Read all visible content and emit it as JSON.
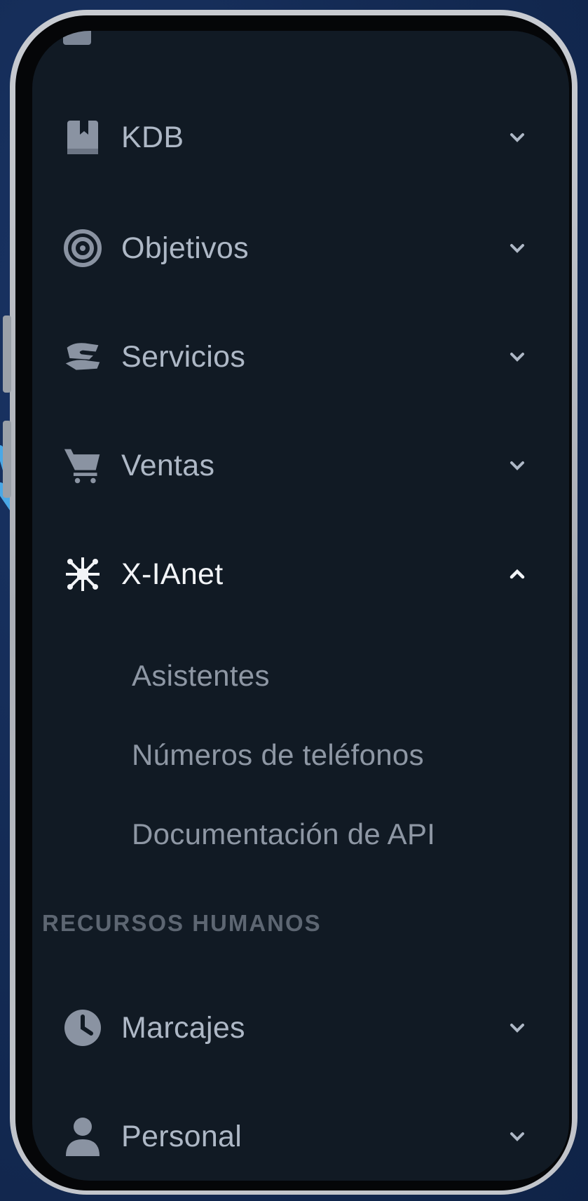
{
  "colors": {
    "background": "#13294f",
    "screen": "#111a24",
    "menu_text": "#aeb8c6",
    "active_text": "#f2f4f7",
    "sub_text": "#8e97a4",
    "section_text": "#5d6672",
    "arrow": "#4aa8e6"
  },
  "sidebar": {
    "items": [
      {
        "label": "KDB",
        "icon": "book-icon",
        "state": "collapsed"
      },
      {
        "label": "Objetivos",
        "icon": "target-icon",
        "state": "collapsed"
      },
      {
        "label": "Servicios",
        "icon": "hand-holding-icon",
        "state": "collapsed"
      },
      {
        "label": "Ventas",
        "icon": "cart-icon",
        "state": "collapsed"
      },
      {
        "label": "X-IAnet",
        "icon": "network-icon",
        "state": "expanded"
      }
    ],
    "subitems": [
      {
        "label": "Asistentes"
      },
      {
        "label": "Números de teléfonos"
      },
      {
        "label": "Documentación de API"
      }
    ],
    "section_title": "RECURSOS HUMANOS",
    "section_items": [
      {
        "label": "Marcajes",
        "icon": "clock-icon",
        "state": "collapsed"
      },
      {
        "label": "Personal",
        "icon": "user-icon",
        "state": "collapsed"
      }
    ]
  }
}
